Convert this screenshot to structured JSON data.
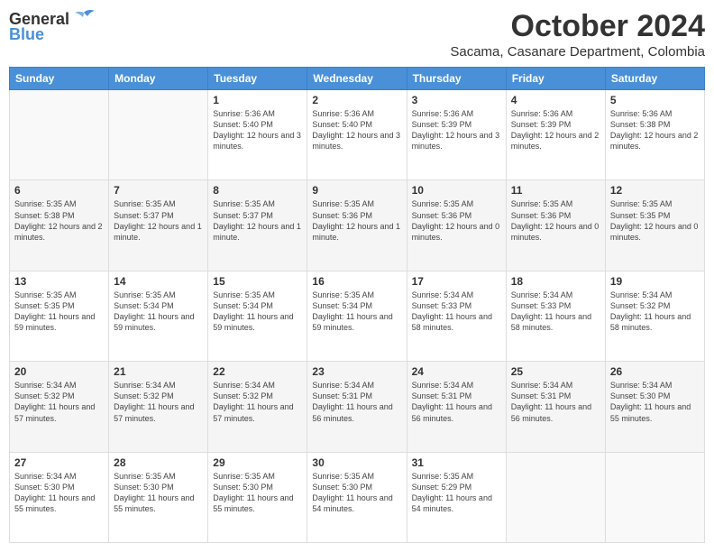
{
  "logo": {
    "line1": "General",
    "line2": "Blue"
  },
  "title": "October 2024",
  "location": "Sacama, Casanare Department, Colombia",
  "weekdays": [
    "Sunday",
    "Monday",
    "Tuesday",
    "Wednesday",
    "Thursday",
    "Friday",
    "Saturday"
  ],
  "weeks": [
    [
      {
        "day": "",
        "info": ""
      },
      {
        "day": "",
        "info": ""
      },
      {
        "day": "1",
        "info": "Sunrise: 5:36 AM\nSunset: 5:40 PM\nDaylight: 12 hours and 3 minutes."
      },
      {
        "day": "2",
        "info": "Sunrise: 5:36 AM\nSunset: 5:40 PM\nDaylight: 12 hours and 3 minutes."
      },
      {
        "day": "3",
        "info": "Sunrise: 5:36 AM\nSunset: 5:39 PM\nDaylight: 12 hours and 3 minutes."
      },
      {
        "day": "4",
        "info": "Sunrise: 5:36 AM\nSunset: 5:39 PM\nDaylight: 12 hours and 2 minutes."
      },
      {
        "day": "5",
        "info": "Sunrise: 5:36 AM\nSunset: 5:38 PM\nDaylight: 12 hours and 2 minutes."
      }
    ],
    [
      {
        "day": "6",
        "info": "Sunrise: 5:35 AM\nSunset: 5:38 PM\nDaylight: 12 hours and 2 minutes."
      },
      {
        "day": "7",
        "info": "Sunrise: 5:35 AM\nSunset: 5:37 PM\nDaylight: 12 hours and 1 minute."
      },
      {
        "day": "8",
        "info": "Sunrise: 5:35 AM\nSunset: 5:37 PM\nDaylight: 12 hours and 1 minute."
      },
      {
        "day": "9",
        "info": "Sunrise: 5:35 AM\nSunset: 5:36 PM\nDaylight: 12 hours and 1 minute."
      },
      {
        "day": "10",
        "info": "Sunrise: 5:35 AM\nSunset: 5:36 PM\nDaylight: 12 hours and 0 minutes."
      },
      {
        "day": "11",
        "info": "Sunrise: 5:35 AM\nSunset: 5:36 PM\nDaylight: 12 hours and 0 minutes."
      },
      {
        "day": "12",
        "info": "Sunrise: 5:35 AM\nSunset: 5:35 PM\nDaylight: 12 hours and 0 minutes."
      }
    ],
    [
      {
        "day": "13",
        "info": "Sunrise: 5:35 AM\nSunset: 5:35 PM\nDaylight: 11 hours and 59 minutes."
      },
      {
        "day": "14",
        "info": "Sunrise: 5:35 AM\nSunset: 5:34 PM\nDaylight: 11 hours and 59 minutes."
      },
      {
        "day": "15",
        "info": "Sunrise: 5:35 AM\nSunset: 5:34 PM\nDaylight: 11 hours and 59 minutes."
      },
      {
        "day": "16",
        "info": "Sunrise: 5:35 AM\nSunset: 5:34 PM\nDaylight: 11 hours and 59 minutes."
      },
      {
        "day": "17",
        "info": "Sunrise: 5:34 AM\nSunset: 5:33 PM\nDaylight: 11 hours and 58 minutes."
      },
      {
        "day": "18",
        "info": "Sunrise: 5:34 AM\nSunset: 5:33 PM\nDaylight: 11 hours and 58 minutes."
      },
      {
        "day": "19",
        "info": "Sunrise: 5:34 AM\nSunset: 5:32 PM\nDaylight: 11 hours and 58 minutes."
      }
    ],
    [
      {
        "day": "20",
        "info": "Sunrise: 5:34 AM\nSunset: 5:32 PM\nDaylight: 11 hours and 57 minutes."
      },
      {
        "day": "21",
        "info": "Sunrise: 5:34 AM\nSunset: 5:32 PM\nDaylight: 11 hours and 57 minutes."
      },
      {
        "day": "22",
        "info": "Sunrise: 5:34 AM\nSunset: 5:32 PM\nDaylight: 11 hours and 57 minutes."
      },
      {
        "day": "23",
        "info": "Sunrise: 5:34 AM\nSunset: 5:31 PM\nDaylight: 11 hours and 56 minutes."
      },
      {
        "day": "24",
        "info": "Sunrise: 5:34 AM\nSunset: 5:31 PM\nDaylight: 11 hours and 56 minutes."
      },
      {
        "day": "25",
        "info": "Sunrise: 5:34 AM\nSunset: 5:31 PM\nDaylight: 11 hours and 56 minutes."
      },
      {
        "day": "26",
        "info": "Sunrise: 5:34 AM\nSunset: 5:30 PM\nDaylight: 11 hours and 55 minutes."
      }
    ],
    [
      {
        "day": "27",
        "info": "Sunrise: 5:34 AM\nSunset: 5:30 PM\nDaylight: 11 hours and 55 minutes."
      },
      {
        "day": "28",
        "info": "Sunrise: 5:35 AM\nSunset: 5:30 PM\nDaylight: 11 hours and 55 minutes."
      },
      {
        "day": "29",
        "info": "Sunrise: 5:35 AM\nSunset: 5:30 PM\nDaylight: 11 hours and 55 minutes."
      },
      {
        "day": "30",
        "info": "Sunrise: 5:35 AM\nSunset: 5:30 PM\nDaylight: 11 hours and 54 minutes."
      },
      {
        "day": "31",
        "info": "Sunrise: 5:35 AM\nSunset: 5:29 PM\nDaylight: 11 hours and 54 minutes."
      },
      {
        "day": "",
        "info": ""
      },
      {
        "day": "",
        "info": ""
      }
    ]
  ]
}
